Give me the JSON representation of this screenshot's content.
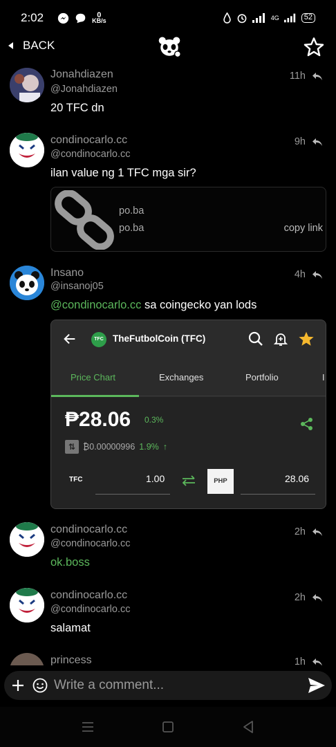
{
  "status_bar": {
    "time": "2:02",
    "net_speed": "0",
    "net_unit": "KB/s",
    "network": "4G",
    "battery": "52"
  },
  "header": {
    "back_label": "BACK"
  },
  "posts": [
    {
      "username": "Jonahdiazen",
      "handle": "@Jonahdiazen",
      "time": "11h",
      "text": "20 TFC dn"
    },
    {
      "username": "condinocarlo.cc",
      "handle": "@condinocarlo.cc",
      "time": "9h",
      "text": "ilan value ng 1 TFC mga sir?",
      "link_preview": {
        "title": "po.ba",
        "domain": "po.ba",
        "copy_label": "copy link"
      }
    },
    {
      "username": "Insano",
      "handle": "@insanoj05",
      "time": "4h",
      "mention": "@condinocarlo.cc",
      "text": " sa coingecko yan lods",
      "screenshot": {
        "coin_badge": "TFC",
        "coin_name": "TheFutbolCoin (TFC)",
        "tabs": [
          "Price Chart",
          "Exchanges",
          "Portfolio",
          "I"
        ],
        "price": "₱28.06",
        "price_change": "0.3%",
        "btc_price": "₿0.00000996",
        "btc_change": "1.9%",
        "from_symbol": "TFC",
        "from_amount": "1.00",
        "to_symbol": "PHP",
        "to_amount": "28.06"
      }
    },
    {
      "username": "condinocarlo.cc",
      "handle": "@condinocarlo.cc",
      "time": "2h",
      "text": "ok.boss"
    },
    {
      "username": "condinocarlo.cc",
      "handle": "@condinocarlo.cc",
      "time": "2h",
      "text": "salamat"
    },
    {
      "username": "princess",
      "time": "1h"
    }
  ],
  "composer": {
    "placeholder": "Write a comment..."
  },
  "colors": {
    "accent_green": "#5cb85c",
    "background": "#000000",
    "muted_text": "#9a9a9a",
    "star_gold": "#f5b82e"
  },
  "icons": [
    "messenger-icon",
    "chat-icon",
    "water-drop-icon",
    "alarm-icon",
    "signal-icon",
    "panda-logo-icon",
    "star-icon",
    "reply-icon",
    "chain-link-icon",
    "plus-icon",
    "emoji-icon",
    "send-icon"
  ]
}
